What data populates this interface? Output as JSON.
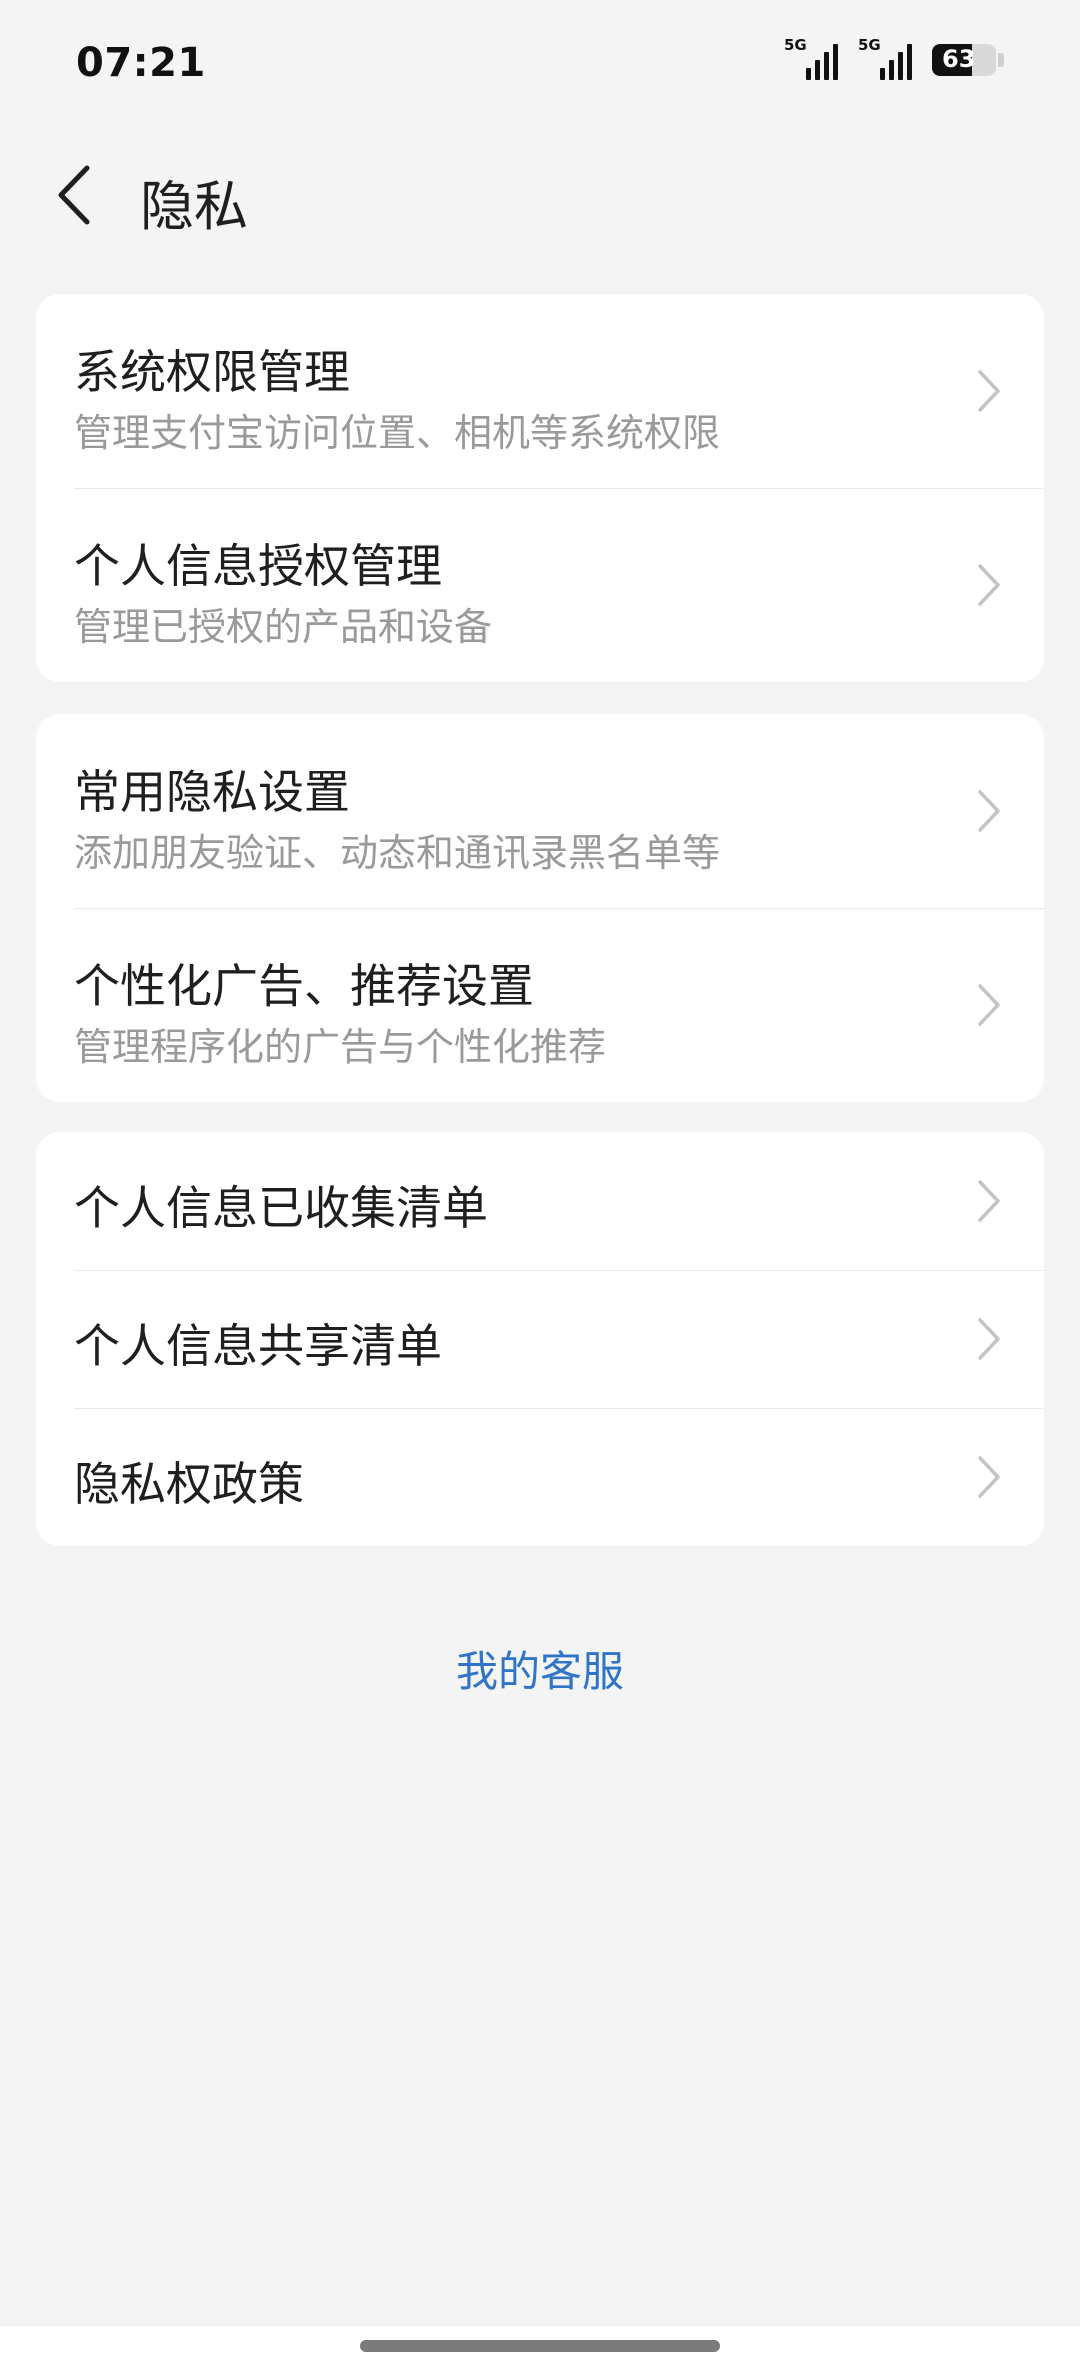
{
  "status_bar": {
    "time": "07:21",
    "signal1_label": "5G",
    "signal2_label": "5G",
    "battery_level": "63",
    "battery_fraction": 0.63
  },
  "header": {
    "title": "隐私"
  },
  "group1": {
    "items": [
      {
        "label": "系统权限管理",
        "sub": "管理支付宝访问位置、相机等系统权限"
      },
      {
        "label": "个人信息授权管理",
        "sub": "管理已授权的产品和设备"
      }
    ]
  },
  "group2": {
    "items": [
      {
        "label": "常用隐私设置",
        "sub": "添加朋友验证、动态和通讯录黑名单等"
      },
      {
        "label": "个性化广告、推荐设置",
        "sub": "管理程序化的广告与个性化推荐"
      }
    ]
  },
  "group3": {
    "items": [
      {
        "label": "个人信息已收集清单"
      },
      {
        "label": "个人信息共享清单"
      },
      {
        "label": "隐私权政策"
      }
    ]
  },
  "footer": {
    "service_link": "我的客服"
  },
  "colors": {
    "background": "#f4f4f4",
    "card": "#ffffff",
    "link": "#2f74c6",
    "subtext": "#9a9a9a",
    "chevron": "#c4c4c4"
  }
}
